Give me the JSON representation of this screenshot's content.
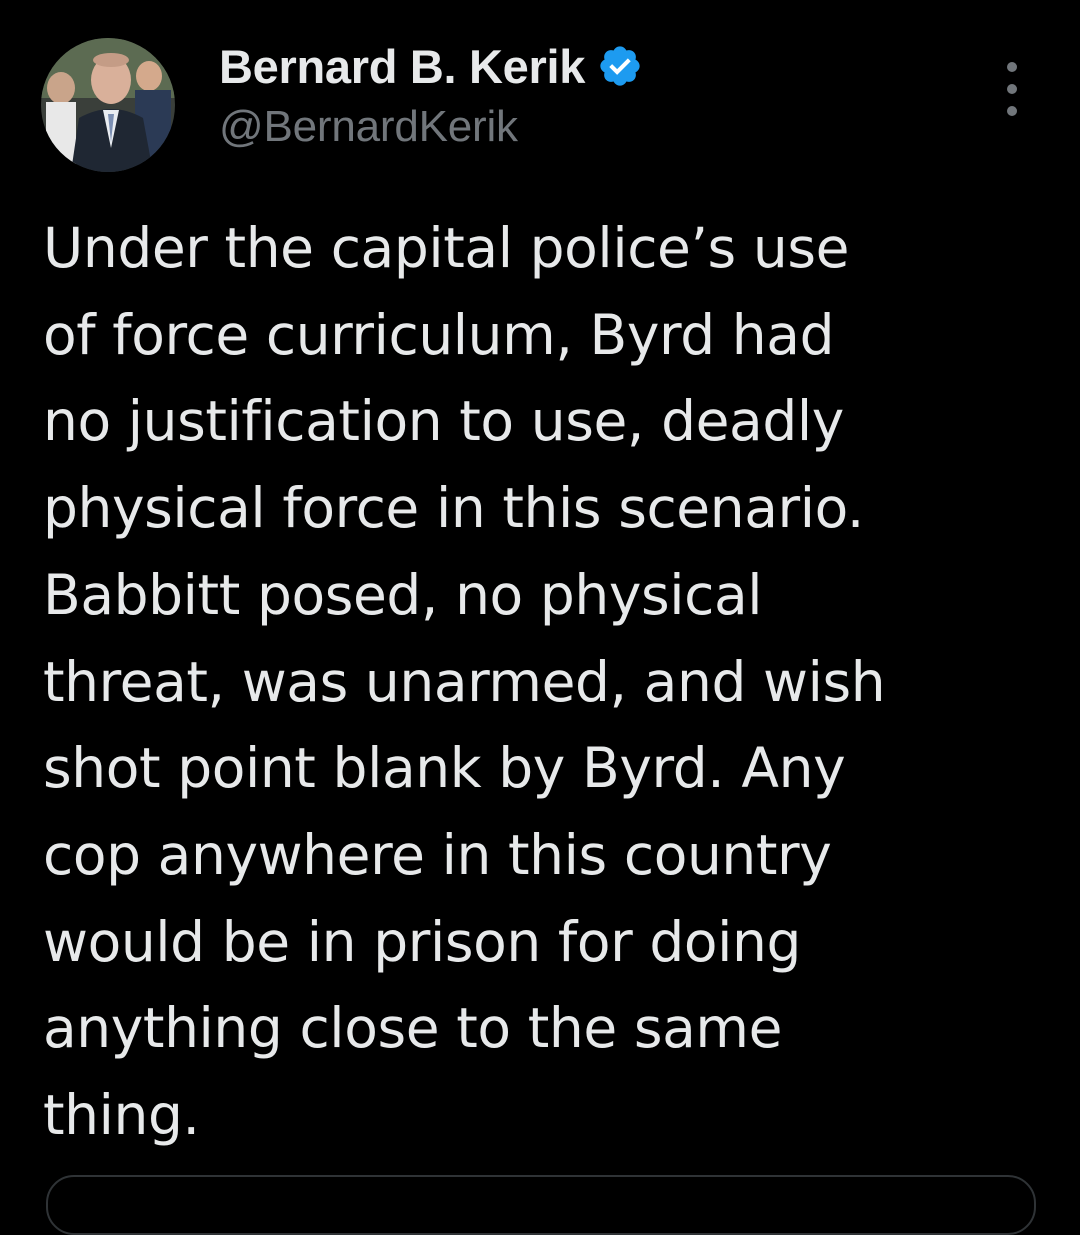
{
  "tweet": {
    "author": {
      "display_name": "Bernard B. Kerik",
      "handle": "@BernardKerik",
      "verified_icon": "verified-badge-icon",
      "avatar_icon": "avatar-photo"
    },
    "more_icon": "more-vertical-icon",
    "text": "Under the capital police’s use\nof force curriculum, Byrd had\nno justification to use, deadly\nphysical force in this scenario.\nBabbitt posed, no physical\nthreat, was unarmed, and wish\nshot point blank by Byrd. Any\ncop anywhere in this country\nwould be in prison for doing\nanything close to the same\nthing."
  },
  "colors": {
    "background": "#000000",
    "text_primary": "#e7e9ea",
    "text_secondary": "#71767b",
    "verified_blue": "#1d9bf0",
    "border": "#2f3336"
  }
}
